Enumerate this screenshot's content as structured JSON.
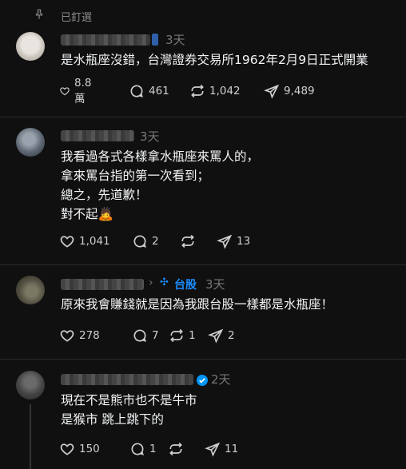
{
  "pinned": {
    "label": "已釘選"
  },
  "posts": [
    {
      "time": "3天",
      "lines": [
        "是水瓶座沒錯，台灣證券交易所1962年2月9日正式開業"
      ],
      "likes": "8.8 萬",
      "comments": "461",
      "reposts": "1,042",
      "shares": "9,489"
    },
    {
      "time": "3天",
      "lines": [
        "我看過各式各樣拿水瓶座來罵人的，",
        "拿來罵台指的第一次看到；",
        "總之，先道歉！",
        "對不起🙇"
      ],
      "likes": "1,041",
      "comments": "2",
      "reposts": "",
      "shares": "13"
    },
    {
      "time": "3天",
      "topic": "台股",
      "lines": [
        "原來我會賺錢就是因為我跟台股一樣都是水瓶座！"
      ],
      "likes": "278",
      "comments": "7",
      "reposts": "1",
      "shares": "2"
    },
    {
      "time": "2天",
      "lines": [
        "現在不是熊市也不是牛市",
        "是猴市 跳上跳下的"
      ],
      "likes": "150",
      "comments": "1",
      "reposts": "",
      "shares": "11"
    }
  ],
  "colors": {
    "background": "#101010",
    "text": "#f3f5f7",
    "muted": "#777777",
    "accent": "#0095f6"
  },
  "icons": [
    "pin-icon",
    "heart-icon",
    "comment-icon",
    "repost-icon",
    "share-icon",
    "verified-icon"
  ]
}
